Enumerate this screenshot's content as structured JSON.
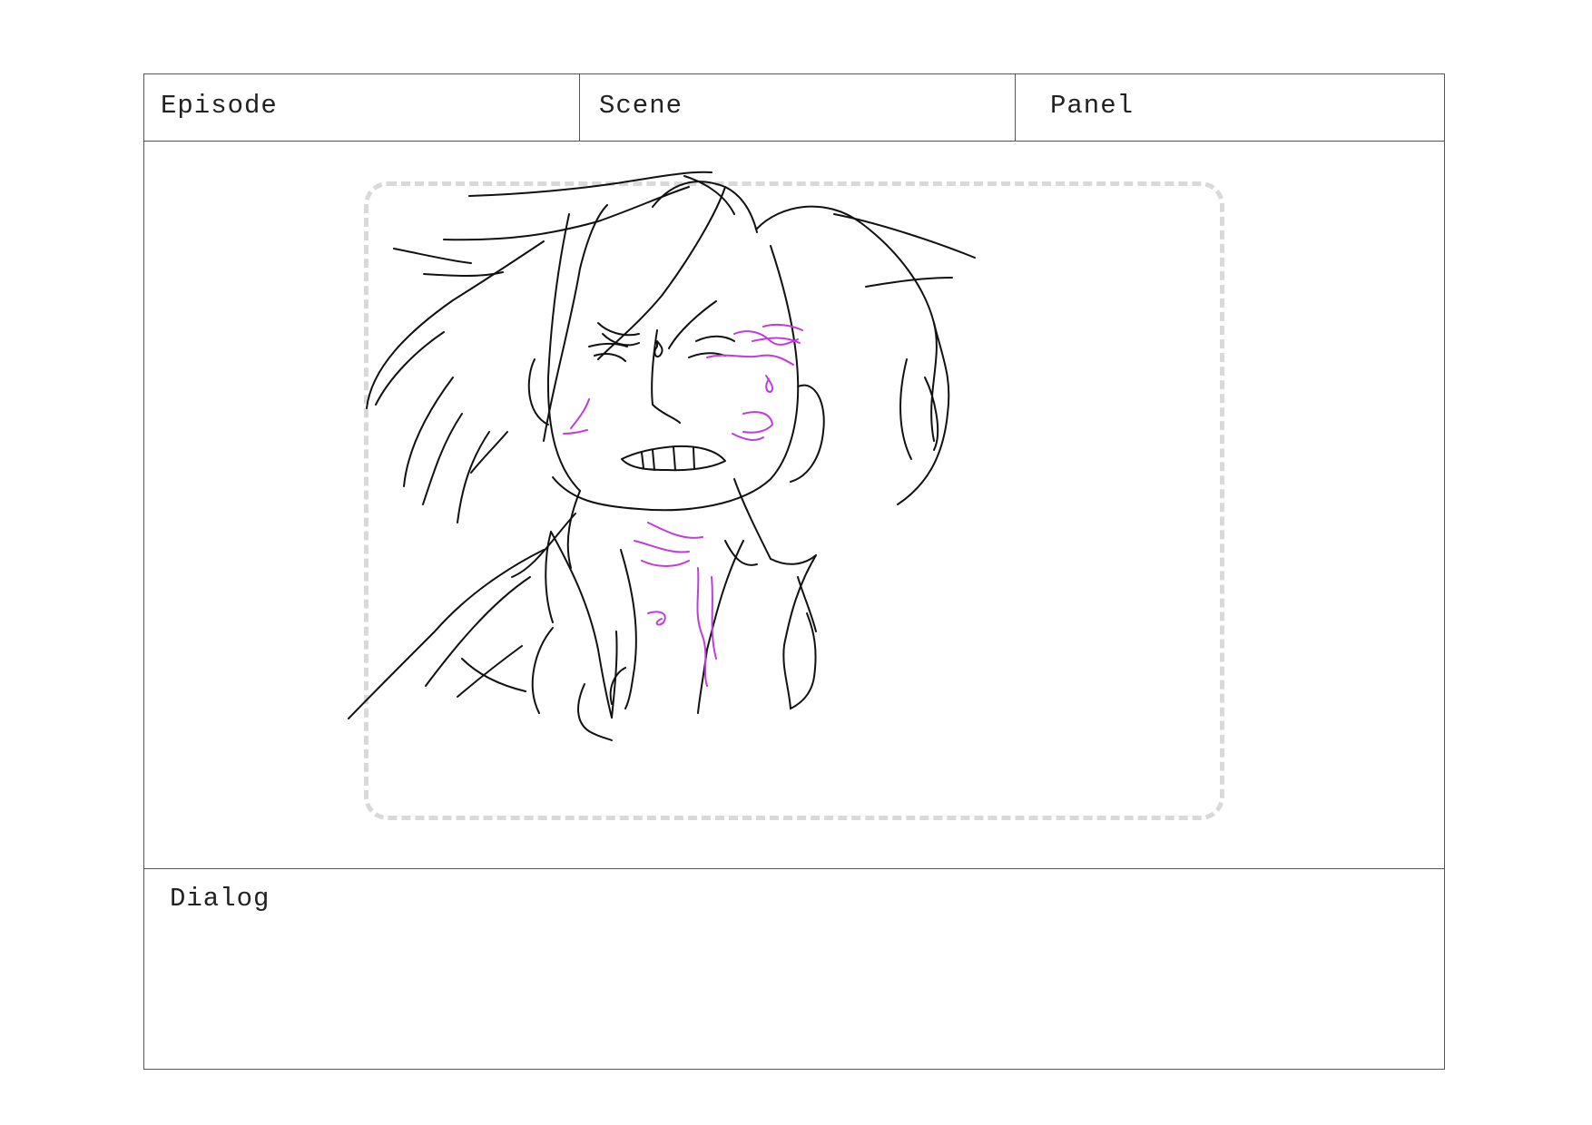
{
  "header": {
    "episode_label": "Episode",
    "scene_label": "Scene",
    "panel_label": "Panel"
  },
  "frame": {
    "sketch_colors": {
      "line": "#111111",
      "annotation": "#c03cdc"
    }
  },
  "dialog": {
    "label": "Dialog"
  }
}
